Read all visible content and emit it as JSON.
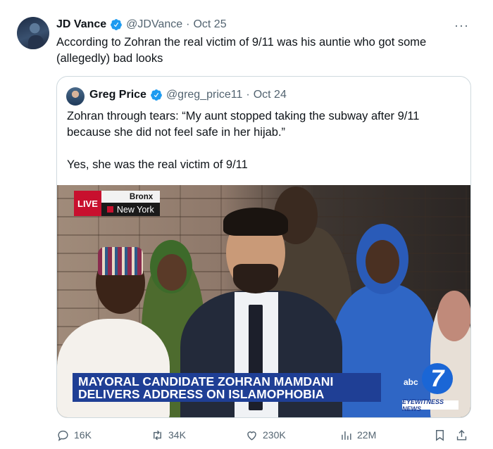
{
  "tweet": {
    "author_name": "JD Vance",
    "author_handle": "@JDVance",
    "separator": "·",
    "date": "Oct 25",
    "more": "···",
    "text": "According to Zohran the real victim of 9/11 was his auntie who got some (allegedly) bad looks"
  },
  "quote": {
    "author_name": "Greg Price",
    "author_handle": "@greg_price11",
    "separator": "·",
    "date": "Oct 24",
    "lines": [
      "Zohran through tears: “My aunt stopped taking the subway after 9/11 because she did not feel safe in her hijab.”",
      "",
      "Yes, she was the real victim of 9/11"
    ],
    "media": {
      "live": "LIVE",
      "location_top": "Bronx",
      "location_bottom": "New York",
      "chyron": "MAYORAL CANDIDATE ZOHRAN MAMDANI DELIVERS ADDRESS ON ISLAMOPHOBIA",
      "logo_abc": "abc",
      "logo_seven": "7",
      "logo_eyewitness": "EYEWITNESS NEWS"
    }
  },
  "actions": {
    "replies": "16K",
    "reposts": "34K",
    "likes": "230K",
    "views": "22M"
  },
  "colors": {
    "verified": "#1d9bf0",
    "muted": "#536471",
    "chyron": "#1f3f95",
    "live": "#c8102e"
  }
}
